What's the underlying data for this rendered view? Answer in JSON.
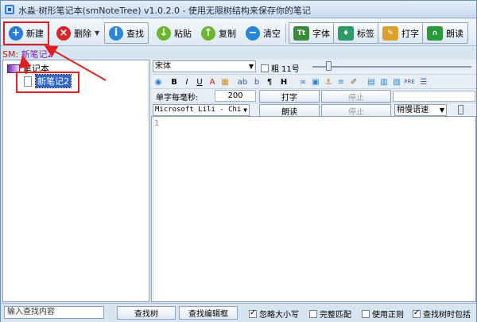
{
  "window": {
    "title": "水淼·树形笔记本(smNoteTree) v1.0.2.0 - 使用无限树结构来保存你的笔记"
  },
  "toolbar": {
    "new_label": "新建",
    "delete_label": "删除",
    "find_label": "查找",
    "paste_label": "粘贴",
    "copy_label": "复制",
    "clear_label": "清空",
    "font_label": "字体",
    "tag_label": "标签",
    "type_label": "打字",
    "read_label": "朗读"
  },
  "sm_line": {
    "prefix": "SM:",
    "note": "新笔记2"
  },
  "tree": {
    "root_label": "笔记本",
    "child_label": "新笔记2"
  },
  "editor": {
    "font_name": "宋体",
    "bold_label": "粗",
    "size_label": "11号",
    "per_char_label": "单字每毫秒:",
    "per_char_value": "200",
    "type_button": "打字",
    "stop_button_1": "停止",
    "voice_name": "Microsoft Lili - Chi",
    "read_button": "朗读",
    "stop_button_2": "停止",
    "speed_select": "稍慢语速",
    "line_number": "1"
  },
  "format_bar": {
    "buttons": [
      "B",
      "I",
      "U",
      "A",
      "ab",
      "b",
      "¶",
      "H"
    ]
  },
  "bottom": {
    "search_placeholder": "输入查找内容",
    "find_tree_button": "查找树",
    "find_editor_button": "查找编辑框",
    "ignore_case": "忽略大小写",
    "whole_match": "完整匹配",
    "use_regex": "使用正则",
    "include_when_find": "查找树时包括"
  },
  "colors": {
    "annotation_red": "#e02020",
    "selection_blue": "#3366cc",
    "sm_red": "#d01818",
    "sm_purple": "#7a1fbf"
  }
}
